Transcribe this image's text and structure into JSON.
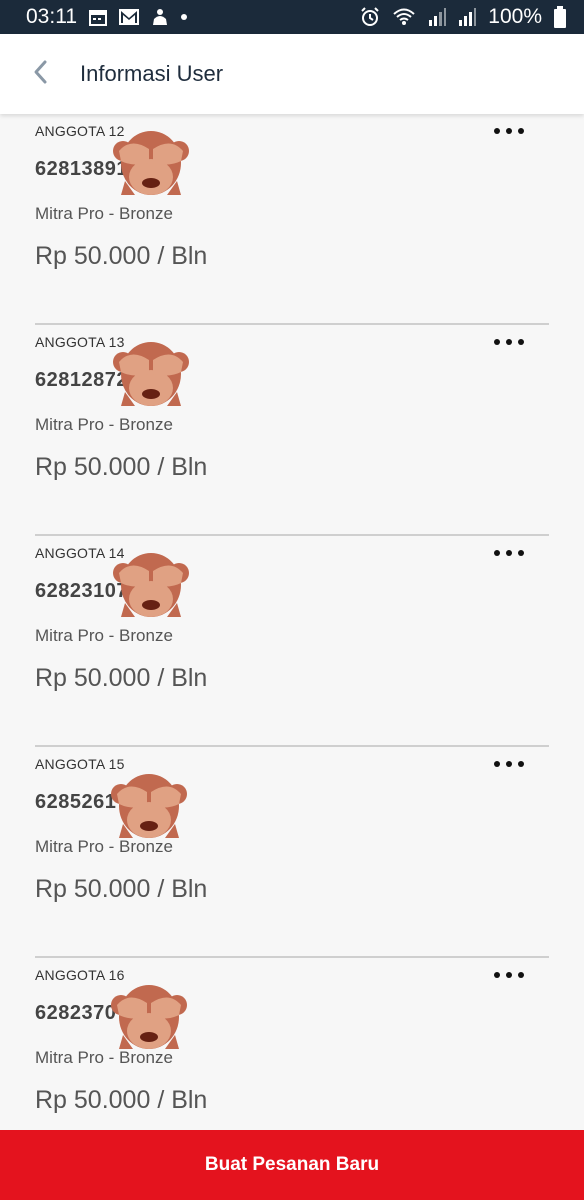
{
  "status_bar": {
    "time": "03:11",
    "battery": "100%",
    "icons": [
      "calendar-icon",
      "gmail-icon",
      "notification-icon",
      "dot-icon",
      "alarm-icon",
      "wifi-icon",
      "signal-icon",
      "signal-icon",
      "battery-icon"
    ]
  },
  "header": {
    "title": "Informasi User",
    "back_icon": "chevron-left-icon"
  },
  "members": [
    {
      "label": "ANGGOTA 12",
      "phone": "62813891",
      "plan": "Mitra Pro - Bronze",
      "price": "Rp 50.000 / Bln"
    },
    {
      "label": "ANGGOTA 13",
      "phone": "62812872",
      "plan": "Mitra Pro - Bronze",
      "price": "Rp 50.000 / Bln"
    },
    {
      "label": "ANGGOTA 14",
      "phone": "62823107",
      "plan": "Mitra Pro - Bronze",
      "price": "Rp 50.000 / Bln"
    },
    {
      "label": "ANGGOTA 15",
      "phone": "6285261",
      "plan": "Mitra Pro - Bronze",
      "price": "Rp 50.000 / Bln"
    },
    {
      "label": "ANGGOTA 16",
      "phone": "6282370",
      "plan": "Mitra Pro - Bronze",
      "price": "Rp 50.000 / Bln"
    }
  ],
  "cta": {
    "label": "Buat Pesanan Baru"
  },
  "colors": {
    "status_bar": "#1b2a3a",
    "cta": "#e4131e",
    "monkey": "#c1694f"
  }
}
